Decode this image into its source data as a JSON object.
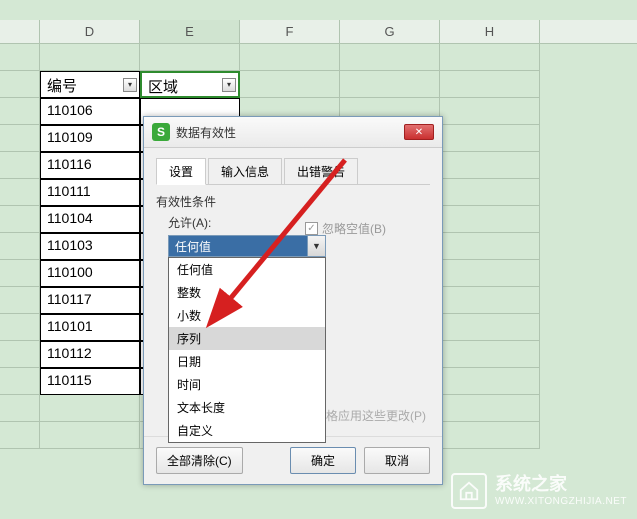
{
  "columns": {
    "D": "D",
    "E": "E",
    "F": "F",
    "G": "G",
    "H": "H"
  },
  "header_row": {
    "d": "编号",
    "e": "区域"
  },
  "rows": [
    "110106",
    "110109",
    "110116",
    "110111",
    "110104",
    "110103",
    "110100",
    "110117",
    "110101",
    "110112",
    "110115"
  ],
  "dialog": {
    "title": "数据有效性",
    "tabs": {
      "settings": "设置",
      "input": "输入信息",
      "error": "出错警告"
    },
    "criteria_label": "有效性条件",
    "allow_label": "允许(A):",
    "selected_value": "任何值",
    "options": [
      "任何值",
      "整数",
      "小数",
      "序列",
      "日期",
      "时间",
      "文本长度",
      "自定义"
    ],
    "highlighted_index": 3,
    "ignore_blank": "忽略空值(B)",
    "apply_all": "所有单元格应用这些更改(P)",
    "buttons": {
      "clear": "全部清除(C)",
      "ok": "确定",
      "cancel": "取消"
    }
  },
  "watermark": {
    "name": "系统之家",
    "url": "WWW.XITONGZHIJIA.NET"
  }
}
